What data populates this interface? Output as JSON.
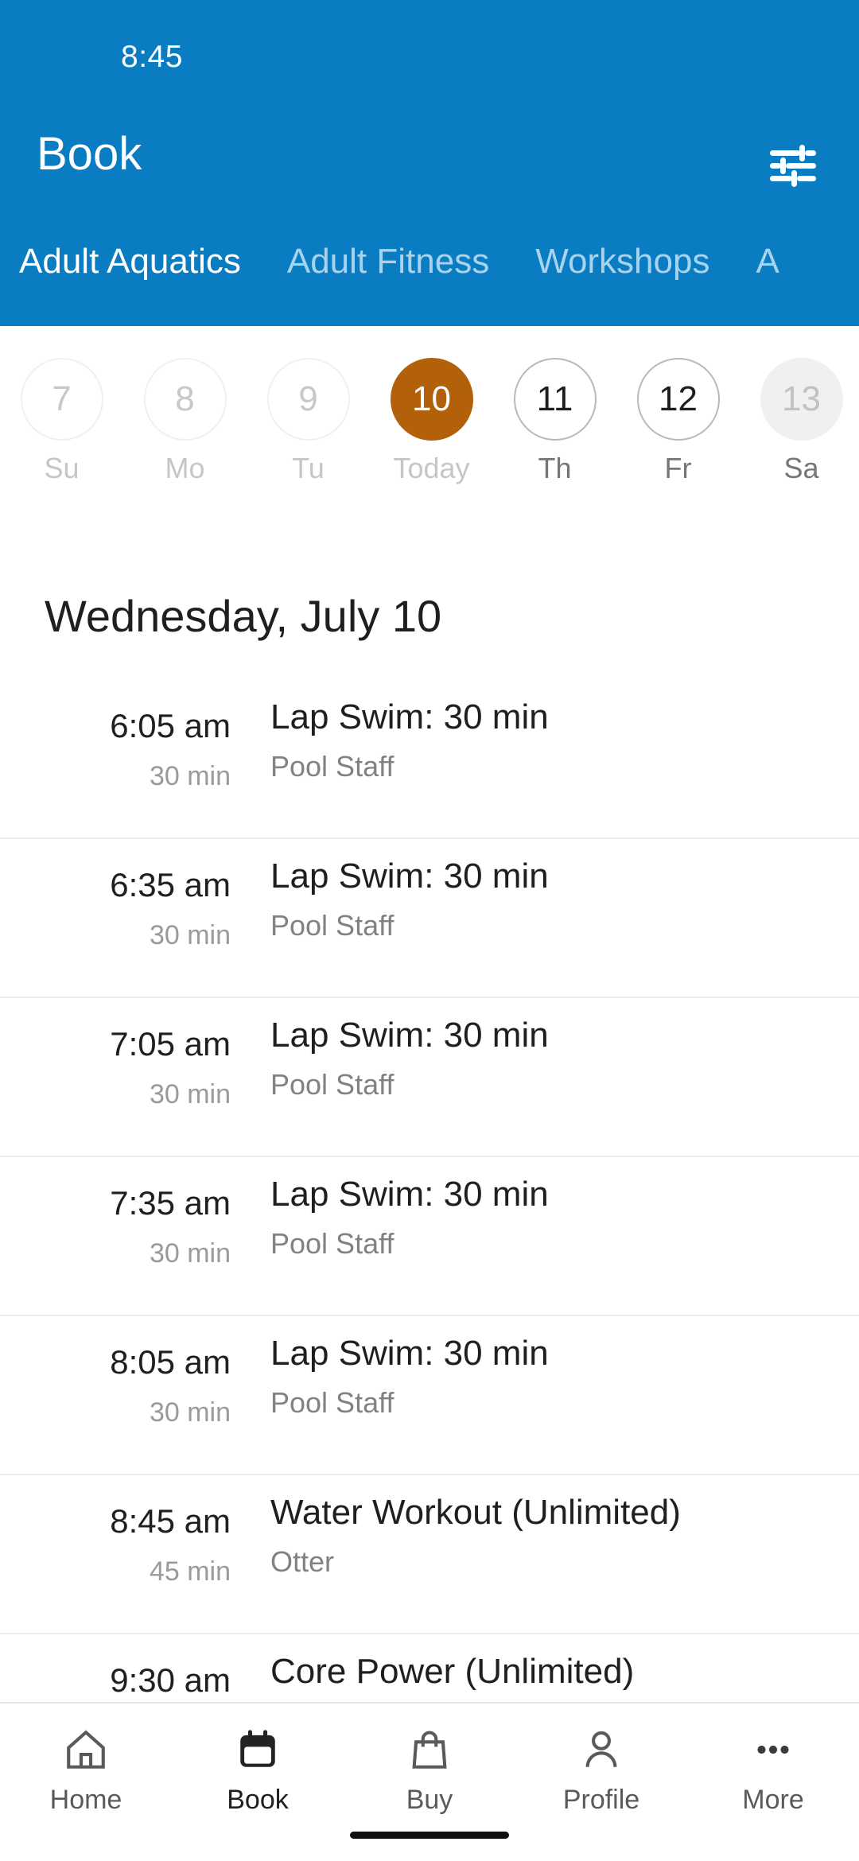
{
  "status_bar": {
    "time": "8:45"
  },
  "app_bar": {
    "title": "Book",
    "filter_icon": "tune-icon"
  },
  "tabs": [
    {
      "label": "Adult Aquatics",
      "active": true
    },
    {
      "label": "Adult Fitness",
      "active": false
    },
    {
      "label": "Workshops",
      "active": false
    },
    {
      "label": "A",
      "active": false
    }
  ],
  "date_strip": [
    {
      "day": "7",
      "weekday": "Su",
      "state": "past"
    },
    {
      "day": "8",
      "weekday": "Mo",
      "state": "past"
    },
    {
      "day": "9",
      "weekday": "Tu",
      "state": "past"
    },
    {
      "day": "10",
      "weekday": "Today",
      "state": "today"
    },
    {
      "day": "11",
      "weekday": "Th",
      "state": "future"
    },
    {
      "day": "12",
      "weekday": "Fr",
      "state": "future"
    },
    {
      "day": "13",
      "weekday": "Sa",
      "state": "filled"
    }
  ],
  "day_heading": "Wednesday, July 10",
  "classes": [
    {
      "time": "6:05 am",
      "duration": "30 min",
      "title": "Lap Swim: 30 min",
      "instructor": "Pool Staff"
    },
    {
      "time": "6:35 am",
      "duration": "30 min",
      "title": "Lap Swim: 30 min",
      "instructor": "Pool Staff"
    },
    {
      "time": "7:05 am",
      "duration": "30 min",
      "title": "Lap Swim: 30 min",
      "instructor": "Pool Staff"
    },
    {
      "time": "7:35 am",
      "duration": "30 min",
      "title": "Lap Swim: 30 min",
      "instructor": "Pool Staff"
    },
    {
      "time": "8:05 am",
      "duration": "30 min",
      "title": "Lap Swim: 30 min",
      "instructor": "Pool Staff"
    },
    {
      "time": "8:45 am",
      "duration": "45 min",
      "title": "Water Workout (Unlimited)",
      "instructor": "Otter"
    },
    {
      "time": "9:30 am",
      "duration": "",
      "title": "Core Power (Unlimited)",
      "instructor": ""
    }
  ],
  "bottom_nav": [
    {
      "label": "Home",
      "icon": "home-icon",
      "active": false
    },
    {
      "label": "Book",
      "icon": "calendar-icon",
      "active": true
    },
    {
      "label": "Buy",
      "icon": "bag-icon",
      "active": false
    },
    {
      "label": "Profile",
      "icon": "person-icon",
      "active": false
    },
    {
      "label": "More",
      "icon": "dots-icon",
      "active": false
    }
  ],
  "colors": {
    "header_blue": "#0a7cc1",
    "today_orange": "#b3600b",
    "tab_inactive": "#a8d3ef",
    "text_primary": "#1f1f1f",
    "text_secondary": "#828282"
  }
}
